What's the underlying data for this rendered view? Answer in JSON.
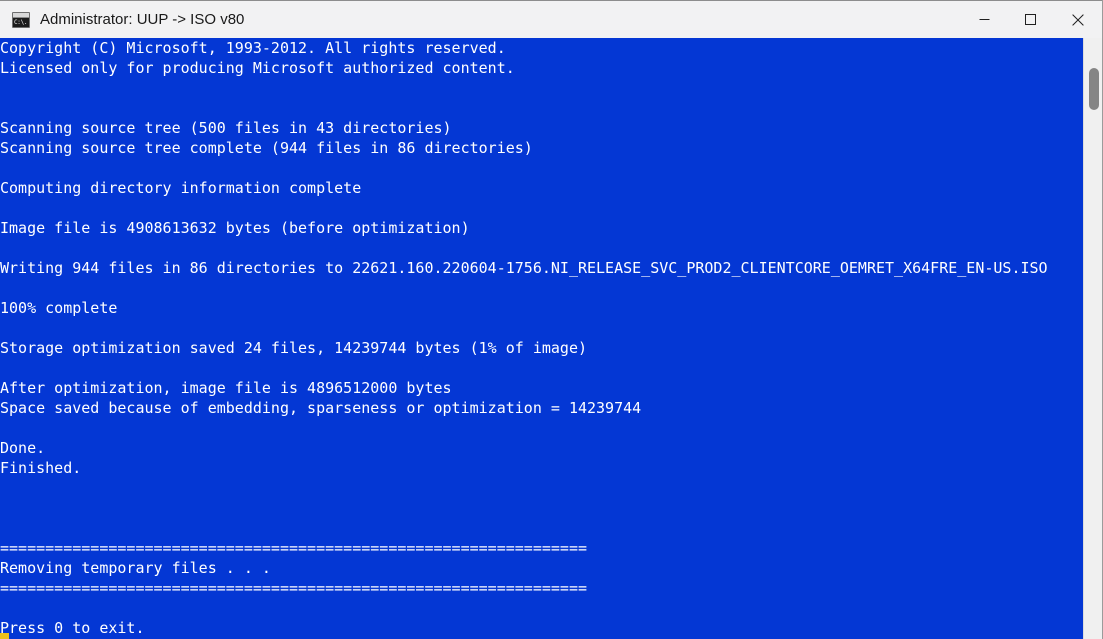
{
  "window": {
    "title": "Administrator:  UUP -> ISO v80",
    "icon_name": "console-window-icon",
    "icon_glyph": "C:\\.",
    "titlebar_bg": "#f2f2f3",
    "console_bg": "#0437d4",
    "console_fg": "#ffffff",
    "cursor_color": "#ecc01c"
  },
  "caption": {
    "minimize_label": "Minimize",
    "maximize_label": "Maximize",
    "close_label": "Close"
  },
  "scrollbar": {
    "thumb_color": "#858585",
    "track_color": "#f0f0f0"
  },
  "console": {
    "lines": [
      "Copyright (C) Microsoft, 1993-2012. All rights reserved.",
      "Licensed only for producing Microsoft authorized content.",
      "",
      "",
      "Scanning source tree (500 files in 43 directories)",
      "Scanning source tree complete (944 files in 86 directories)",
      "",
      "Computing directory information complete",
      "",
      "Image file is 4908613632 bytes (before optimization)",
      "",
      "Writing 944 files in 86 directories to 22621.160.220604-1756.NI_RELEASE_SVC_PROD2_CLIENTCORE_OEMRET_X64FRE_EN-US.ISO",
      "",
      "100% complete",
      "",
      "Storage optimization saved 24 files, 14239744 bytes (1% of image)",
      "",
      "After optimization, image file is 4896512000 bytes",
      "Space saved because of embedding, sparseness or optimization = 14239744",
      "",
      "Done.",
      "Finished.",
      "",
      "",
      "",
      "=================================================================",
      "Removing temporary files . . .",
      "=================================================================",
      "",
      "Press 0 to exit."
    ]
  }
}
